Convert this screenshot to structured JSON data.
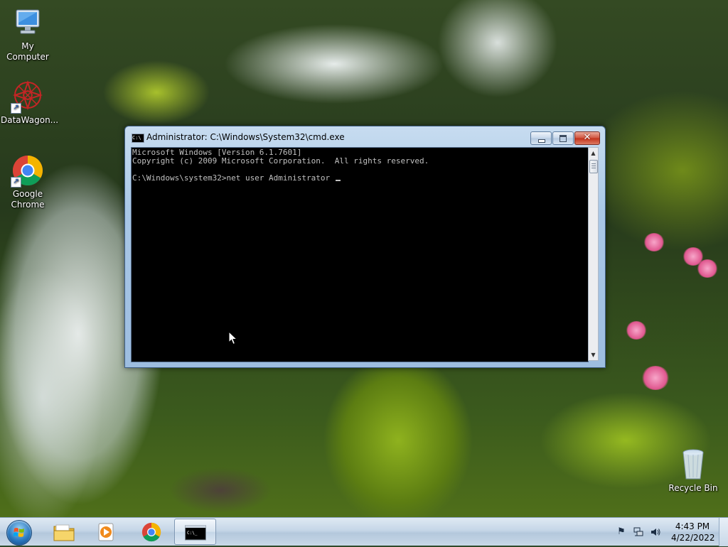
{
  "desktop": {
    "icons": [
      {
        "label": "My Computer",
        "icon": "computer-icon"
      },
      {
        "label": "DataWagon...",
        "icon": "datawagon-icon"
      },
      {
        "label": "Google Chrome",
        "icon": "chrome-icon"
      },
      {
        "label": "Recycle Bin",
        "icon": "recycle-bin-icon"
      }
    ]
  },
  "cmd": {
    "title": "Administrator: C:\\Windows\\System32\\cmd.exe",
    "icon_text": "C:\\",
    "lines": [
      "Microsoft Windows [Version 6.1.7601]",
      "Copyright (c) 2009 Microsoft Corporation.  All rights reserved.",
      "",
      "C:\\Windows\\system32>net user Administrator "
    ],
    "close_glyph": "✕"
  },
  "taskbar": {
    "items": [
      {
        "name": "windows-explorer",
        "icon": "folder-icon"
      },
      {
        "name": "windows-media-player",
        "icon": "media-player-icon"
      },
      {
        "name": "google-chrome",
        "icon": "chrome-icon"
      },
      {
        "name": "command-prompt",
        "icon": "cmd-icon",
        "active": true
      }
    ],
    "clock_time": "4:43 PM",
    "clock_date": "4/22/2022",
    "tray_icons": [
      "flag-icon",
      "network-icon",
      "volume-icon"
    ]
  },
  "colors": {
    "console_bg": "#000000",
    "console_text": "#c0c0c0",
    "title_glass": "#a9c7e6",
    "close_red": "#c2311a"
  }
}
